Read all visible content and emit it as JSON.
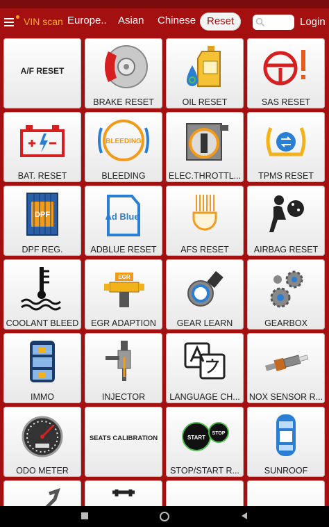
{
  "topbar": {
    "brand": "VIN scan",
    "tabs": [
      {
        "label": "Europe.."
      },
      {
        "label": "Asian"
      },
      {
        "label": "Chinese"
      },
      {
        "label": "Reset",
        "active": true
      }
    ],
    "search_placeholder": "",
    "login": "Login"
  },
  "colors": {
    "bar": "#a40f10",
    "accent": "#ffb21a",
    "tile": "#f0f0f0"
  },
  "tiles": [
    {
      "label": "",
      "center_text": "A/F RESET",
      "icon": "none"
    },
    {
      "label": "BRAKE RESET",
      "icon": "brake-disc-icon"
    },
    {
      "label": "OIL RESET",
      "icon": "oil-bottle-icon"
    },
    {
      "label": "SAS RESET",
      "icon": "steering-warning-icon"
    },
    {
      "label": "BAT. RESET",
      "icon": "battery-icon"
    },
    {
      "label": "BLEEDING",
      "icon": "bleeding-icon",
      "icon_text": "BLEEDING"
    },
    {
      "label": "ELEC.THROTTL...",
      "icon": "throttle-icon"
    },
    {
      "label": "TPMS RESET",
      "icon": "tpms-icon"
    },
    {
      "label": "DPF REG.",
      "icon": "dpf-icon",
      "icon_text": "DPF"
    },
    {
      "label": "ADBLUE RESET",
      "icon": "adblue-icon",
      "icon_text": "Ad Blue"
    },
    {
      "label": "AFS RESET",
      "icon": "headlight-icon"
    },
    {
      "label": "AIRBAG RESET",
      "icon": "airbag-icon"
    },
    {
      "label": "COOLANT BLEED",
      "icon": "coolant-icon"
    },
    {
      "label": "EGR ADAPTION",
      "icon": "egr-icon",
      "icon_text": "EGR"
    },
    {
      "label": "GEAR LEARN",
      "icon": "gear-learn-icon"
    },
    {
      "label": "GEARBOX",
      "icon": "gearbox-icon"
    },
    {
      "label": "IMMO",
      "icon": "immo-icon"
    },
    {
      "label": "INJECTOR",
      "icon": "injector-icon"
    },
    {
      "label": "LANGUAGE CH...",
      "icon": "language-icon"
    },
    {
      "label": "NOX SENSOR R...",
      "icon": "nox-sensor-icon"
    },
    {
      "label": "ODO METER",
      "icon": "odometer-icon"
    },
    {
      "label": "",
      "center_text": "SEATS CALIBRATION",
      "icon": "none"
    },
    {
      "label": "STOP/START R...",
      "icon": "stop-start-icon",
      "icon_text": "START",
      "icon_text2": "STOP"
    },
    {
      "label": "SUNROOF",
      "icon": "sunroof-icon"
    },
    {
      "label": "",
      "icon": "wrench-icon"
    },
    {
      "label": "",
      "icon": "tools-icon"
    },
    {
      "label": "",
      "icon": "none"
    },
    {
      "label": "",
      "icon": "none"
    }
  ]
}
